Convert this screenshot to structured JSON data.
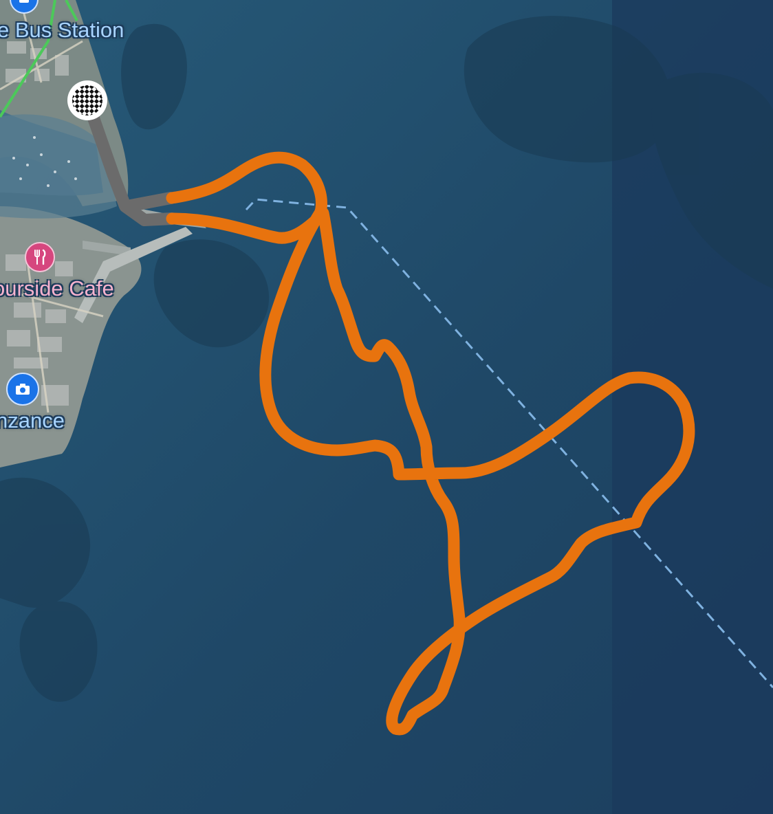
{
  "map": {
    "labels": {
      "bus_station": "e Bus Station",
      "cafe": "ourside Cafe",
      "town": "nzance"
    },
    "icons": {
      "food_pin": "restaurant-icon",
      "photo_pin": "camera-icon",
      "bus_pin": "bus-icon",
      "finish": "checkered-flag-icon"
    },
    "colors": {
      "route": "#e8730e",
      "route_inactive": "#6b6b6b",
      "boundary": "#7fb2e0",
      "road": "#4cc95a",
      "water_deep": "#1e4466",
      "water": "#24506e"
    }
  }
}
